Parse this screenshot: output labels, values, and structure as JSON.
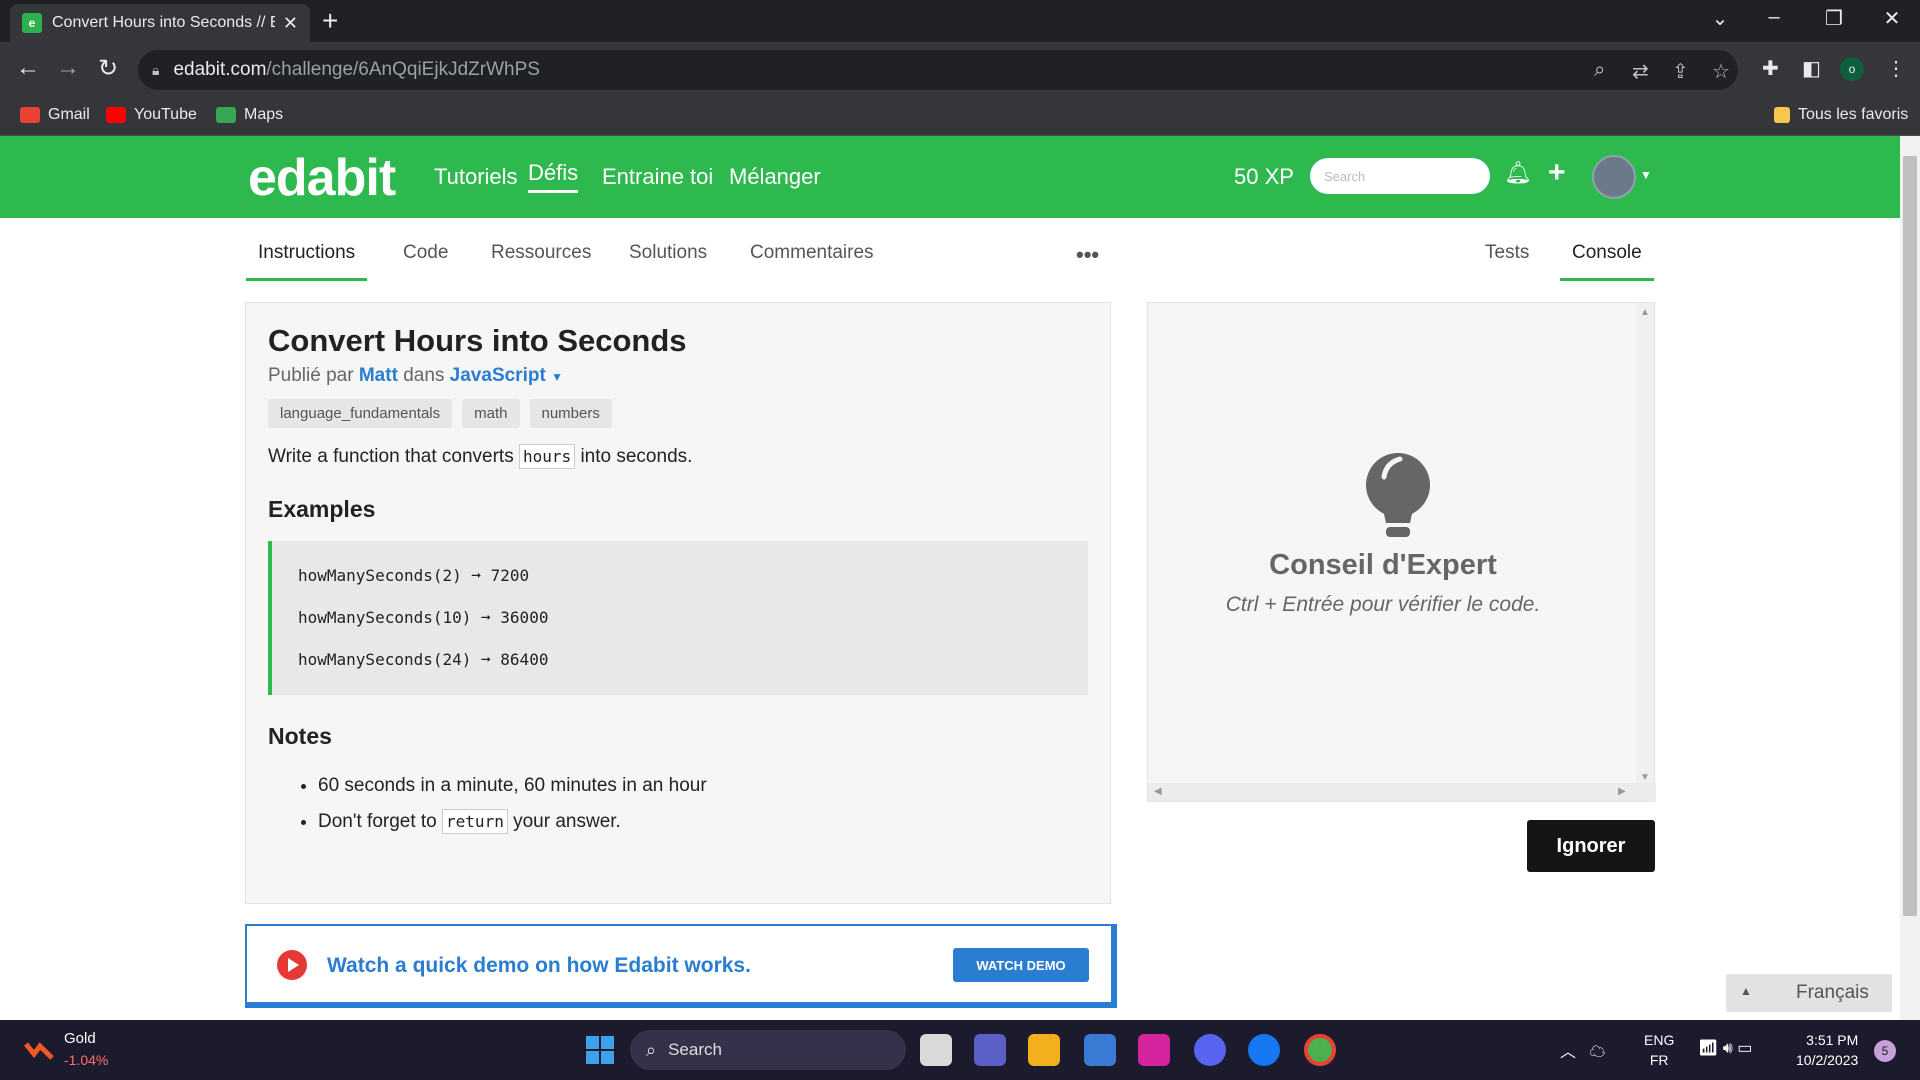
{
  "browser": {
    "tab_title": "Convert Hours into Seconds // E",
    "url_host": "edabit.com",
    "url_path": "/challenge/6AnQqiEjkJdZrWhPS",
    "profile_initial": "o",
    "bookmarks": [
      "Gmail",
      "YouTube",
      "Maps"
    ],
    "all_favorites": "Tous les favoris"
  },
  "header": {
    "logo": "edabit",
    "nav": [
      "Tutoriels",
      "Défis",
      "Entraine toi",
      "Mélanger"
    ],
    "xp": "50 XP",
    "search_placeholder": "Search"
  },
  "subtabs": {
    "left": [
      "Instructions",
      "Code",
      "Ressources",
      "Solutions",
      "Commentaires"
    ],
    "more": "•••",
    "right": [
      "Tests",
      "Console"
    ]
  },
  "challenge": {
    "title": "Convert Hours into Seconds",
    "published_by": "Publié par",
    "author": "Matt",
    "in": "dans",
    "language": "JavaScript",
    "tags": [
      "language_fundamentals",
      "math",
      "numbers"
    ],
    "desc_before": "Write a function that converts",
    "desc_code": "hours",
    "desc_after": "into seconds.",
    "examples_heading": "Examples",
    "examples": [
      "howManySeconds(2) ➞ 7200",
      "howManySeconds(10) ➞ 36000",
      "howManySeconds(24) ➞ 86400"
    ],
    "notes_heading": "Notes",
    "note1": "60 seconds in a minute, 60 minutes in an hour",
    "note2_before": "Don't forget to",
    "note2_code": "return",
    "note2_after": "your answer."
  },
  "console": {
    "tip_title": "Conseil d'Expert",
    "tip_text": "Ctrl + Entrée pour vérifier le code.",
    "ignore_label": "Ignorer"
  },
  "demo": {
    "text": "Watch a quick demo on how Edabit works.",
    "button": "WATCH DEMO"
  },
  "language_selector": "Français",
  "taskbar": {
    "weather_name": "Gold",
    "weather_value": "-1.04%",
    "search_label": "Search",
    "lang_line1": "ENG",
    "lang_line2": "FR",
    "time": "3:51 PM",
    "date": "10/2/2023",
    "notifications": "5"
  },
  "colors": {
    "edabit_green": "#2eb94f",
    "link_blue": "#2a7dd1"
  }
}
